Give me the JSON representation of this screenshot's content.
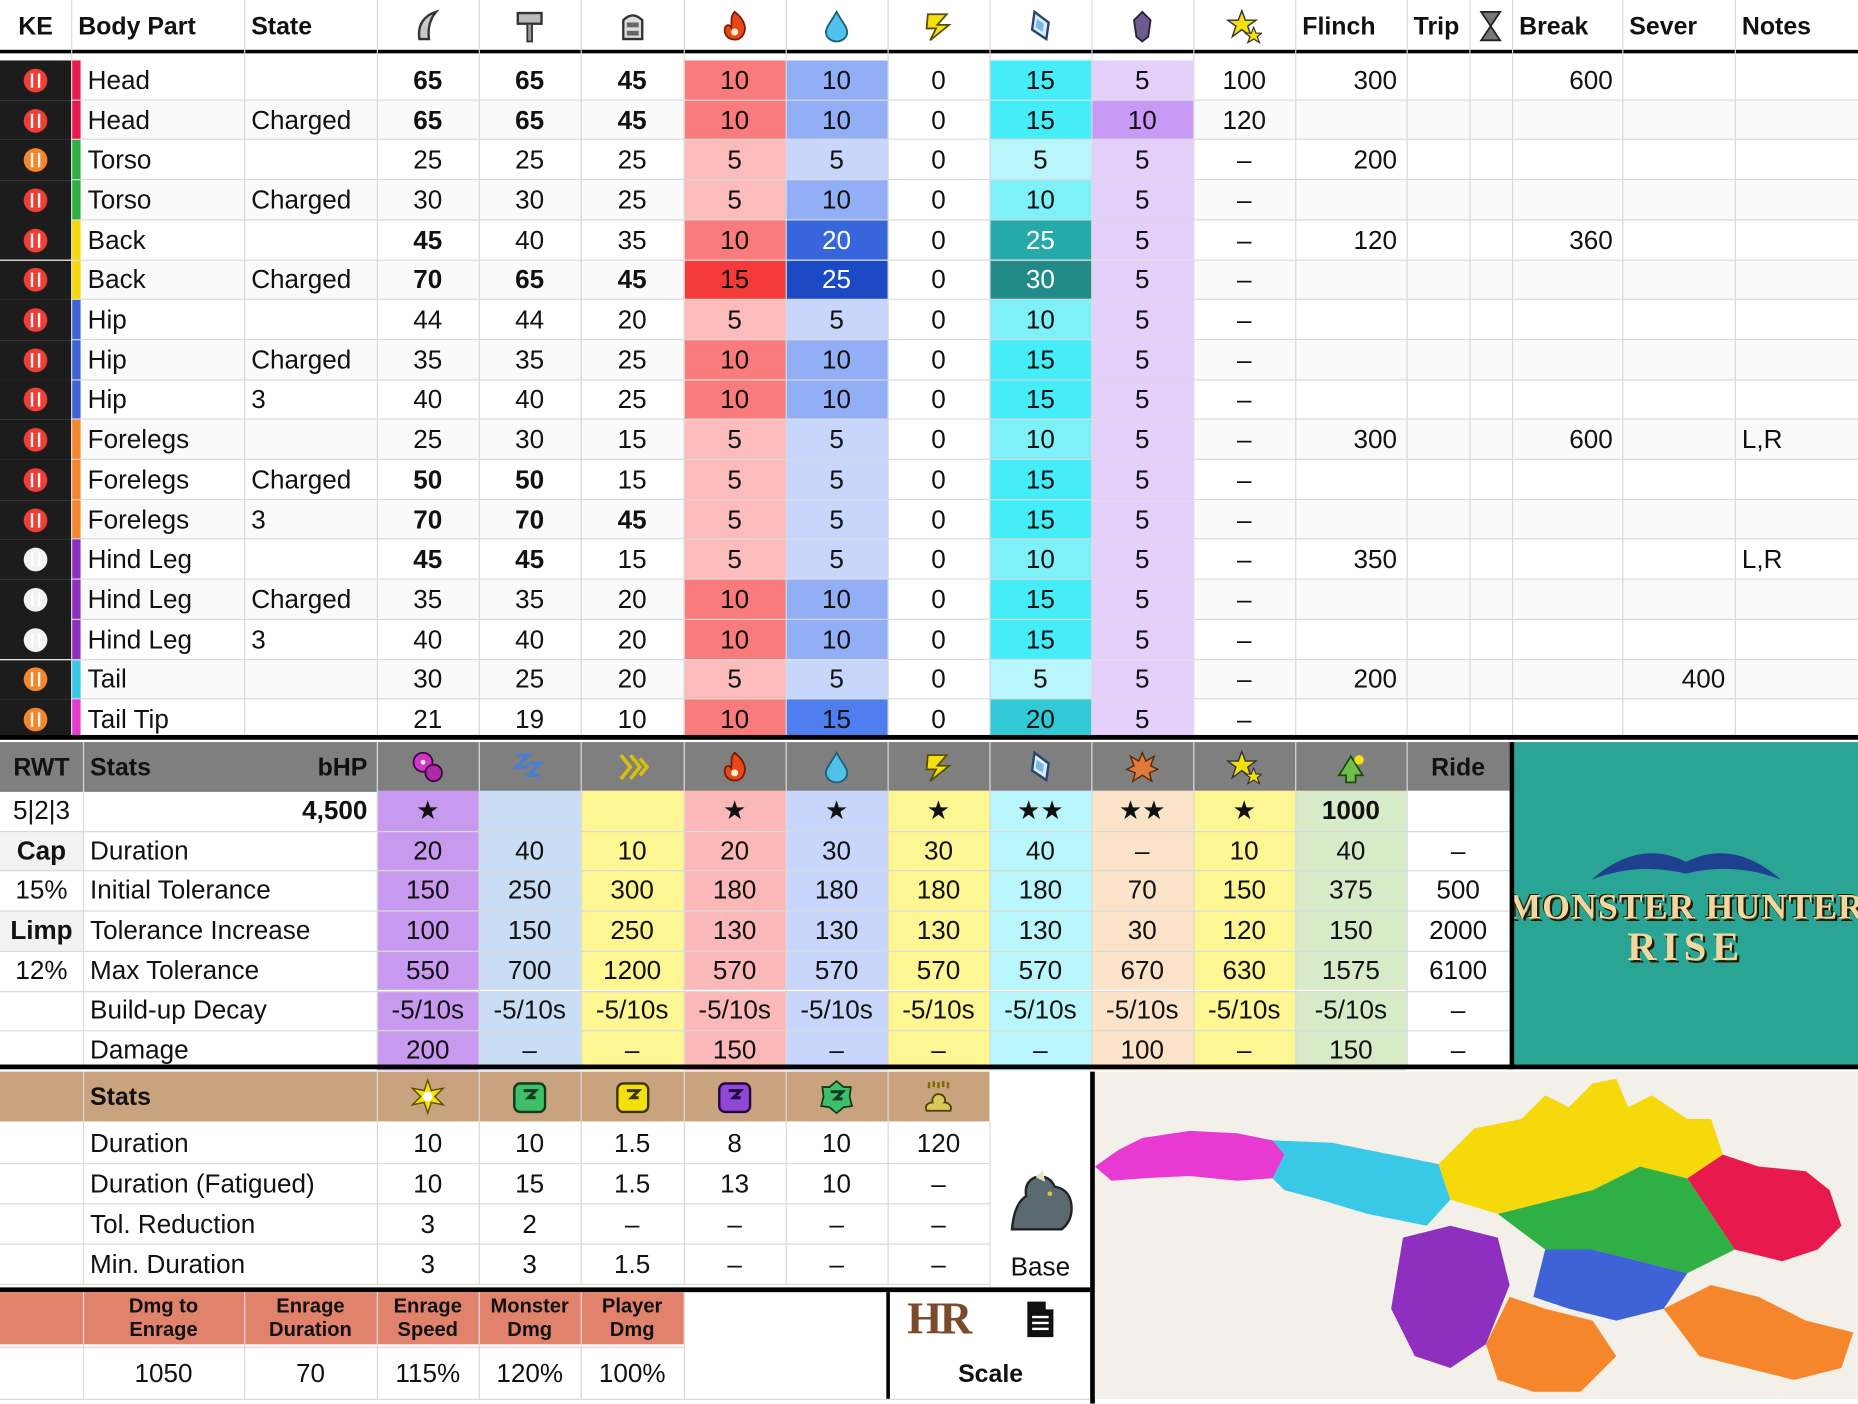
{
  "colors": {
    "weak_bg": "#f2f2f2",
    "header_bg": "#ffffff",
    "ke_column_bg": "#1c1c1c",
    "mid_header_bg": "#7f7f7f",
    "lower_header_bg": "#c9a27e",
    "enrage_header_bg": "#e0826c",
    "logo_panel_bg": "#2aa595",
    "map_bg": "#f3efe9"
  },
  "top_table": {
    "headers": {
      "ke": "KE",
      "body_part": "Body Part",
      "state": "State",
      "flinch": "Flinch",
      "trip": "Trip",
      "break": "Break",
      "sever": "Sever",
      "notes": "Notes"
    },
    "icon_headers": [
      "sever-icon",
      "blunt-icon",
      "ammo-icon",
      "fire-icon",
      "water-icon",
      "thunder-icon",
      "ice-icon",
      "dragon-icon",
      "stun-icon",
      "hourglass-icon"
    ],
    "rows": [
      {
        "ke": "red",
        "color": "#e8194d",
        "part": "Head",
        "state": "",
        "cut": "65",
        "blunt": "65",
        "ammo": "45",
        "fire": "10",
        "water": "10",
        "thunder": "0",
        "ice": "15",
        "dragon": "5",
        "stun": "100",
        "flinch": "300",
        "trip": "",
        "break": "600",
        "sever": "",
        "notes": ""
      },
      {
        "ke": "red",
        "color": "#e8194d",
        "part": "Head",
        "state": "Charged",
        "cut": "65",
        "blunt": "65",
        "ammo": "45",
        "fire": "10",
        "water": "10",
        "thunder": "0",
        "ice": "15",
        "dragon": "10",
        "stun": "120",
        "flinch": "",
        "trip": "",
        "break": "",
        "sever": "",
        "notes": ""
      },
      {
        "ke": "orange",
        "color": "#2fb044",
        "part": "Torso",
        "state": "",
        "cut": "25",
        "blunt": "25",
        "ammo": "25",
        "fire": "5",
        "water": "5",
        "thunder": "0",
        "ice": "5",
        "dragon": "5",
        "stun": "–",
        "flinch": "200",
        "trip": "",
        "break": "",
        "sever": "",
        "notes": ""
      },
      {
        "ke": "red",
        "color": "#2fb044",
        "part": "Torso",
        "state": "Charged",
        "cut": "30",
        "blunt": "30",
        "ammo": "25",
        "fire": "5",
        "water": "10",
        "thunder": "0",
        "ice": "10",
        "dragon": "5",
        "stun": "–",
        "flinch": "",
        "trip": "",
        "break": "",
        "sever": "",
        "notes": ""
      },
      {
        "ke": "red",
        "color": "#f6d90a",
        "part": "Back",
        "state": "",
        "cut": "45",
        "blunt": "40",
        "ammo": "35",
        "fire": "10",
        "water": "20",
        "thunder": "0",
        "ice": "25",
        "dragon": "5",
        "stun": "–",
        "flinch": "120",
        "trip": "",
        "break": "360",
        "sever": "",
        "notes": ""
      },
      {
        "ke": "red",
        "color": "#f6d90a",
        "part": "Back",
        "state": "Charged",
        "cut": "70",
        "blunt": "65",
        "ammo": "45",
        "fire": "15",
        "water": "25",
        "thunder": "0",
        "ice": "30",
        "dragon": "5",
        "stun": "–",
        "flinch": "",
        "trip": "",
        "break": "",
        "sever": "",
        "notes": ""
      },
      {
        "ke": "red",
        "color": "#3f63d6",
        "part": "Hip",
        "state": "",
        "cut": "44",
        "blunt": "44",
        "ammo": "20",
        "fire": "5",
        "water": "5",
        "thunder": "0",
        "ice": "10",
        "dragon": "5",
        "stun": "–",
        "flinch": "",
        "trip": "",
        "break": "",
        "sever": "",
        "notes": ""
      },
      {
        "ke": "red",
        "color": "#3f63d6",
        "part": "Hip",
        "state": "Charged",
        "cut": "35",
        "blunt": "35",
        "ammo": "25",
        "fire": "10",
        "water": "10",
        "thunder": "0",
        "ice": "15",
        "dragon": "5",
        "stun": "–",
        "flinch": "",
        "trip": "",
        "break": "",
        "sever": "",
        "notes": ""
      },
      {
        "ke": "red",
        "color": "#3f63d6",
        "part": "Hip",
        "state": "3",
        "cut": "40",
        "blunt": "40",
        "ammo": "25",
        "fire": "10",
        "water": "10",
        "thunder": "0",
        "ice": "15",
        "dragon": "5",
        "stun": "–",
        "flinch": "",
        "trip": "",
        "break": "",
        "sever": "",
        "notes": ""
      },
      {
        "ke": "red",
        "color": "#f5862b",
        "part": "Forelegs",
        "state": "",
        "cut": "25",
        "blunt": "30",
        "ammo": "15",
        "fire": "5",
        "water": "5",
        "thunder": "0",
        "ice": "10",
        "dragon": "5",
        "stun": "–",
        "flinch": "300",
        "trip": "",
        "break": "600",
        "sever": "",
        "notes": "L,R"
      },
      {
        "ke": "red",
        "color": "#f5862b",
        "part": "Forelegs",
        "state": "Charged",
        "cut": "50",
        "blunt": "50",
        "ammo": "15",
        "fire": "5",
        "water": "5",
        "thunder": "0",
        "ice": "15",
        "dragon": "5",
        "stun": "–",
        "flinch": "",
        "trip": "",
        "break": "",
        "sever": "",
        "notes": ""
      },
      {
        "ke": "red",
        "color": "#f5862b",
        "part": "Forelegs",
        "state": "3",
        "cut": "70",
        "blunt": "70",
        "ammo": "45",
        "fire": "5",
        "water": "5",
        "thunder": "0",
        "ice": "15",
        "dragon": "5",
        "stun": "–",
        "flinch": "",
        "trip": "",
        "break": "",
        "sever": "",
        "notes": ""
      },
      {
        "ke": "white",
        "color": "#8e2fbf",
        "part": "Hind Leg",
        "state": "",
        "cut": "45",
        "blunt": "45",
        "ammo": "15",
        "fire": "5",
        "water": "5",
        "thunder": "0",
        "ice": "10",
        "dragon": "5",
        "stun": "–",
        "flinch": "350",
        "trip": "",
        "break": "",
        "sever": "",
        "notes": "L,R"
      },
      {
        "ke": "white",
        "color": "#8e2fbf",
        "part": "Hind Leg",
        "state": "Charged",
        "cut": "35",
        "blunt": "35",
        "ammo": "20",
        "fire": "10",
        "water": "10",
        "thunder": "0",
        "ice": "15",
        "dragon": "5",
        "stun": "–",
        "flinch": "",
        "trip": "",
        "break": "",
        "sever": "",
        "notes": ""
      },
      {
        "ke": "white",
        "color": "#8e2fbf",
        "part": "Hind Leg",
        "state": "3",
        "cut": "40",
        "blunt": "40",
        "ammo": "20",
        "fire": "10",
        "water": "10",
        "thunder": "0",
        "ice": "15",
        "dragon": "5",
        "stun": "–",
        "flinch": "",
        "trip": "",
        "break": "",
        "sever": "",
        "notes": ""
      },
      {
        "ke": "orange",
        "color": "#39c8e6",
        "part": "Tail",
        "state": "",
        "cut": "30",
        "blunt": "25",
        "ammo": "20",
        "fire": "5",
        "water": "5",
        "thunder": "0",
        "ice": "5",
        "dragon": "5",
        "stun": "–",
        "flinch": "200",
        "trip": "",
        "break": "",
        "sever": "400",
        "notes": ""
      },
      {
        "ke": "orange",
        "color": "#e83ad2",
        "part": "Tail Tip",
        "state": "",
        "cut": "21",
        "blunt": "19",
        "ammo": "10",
        "fire": "10",
        "water": "15",
        "thunder": "0",
        "ice": "20",
        "dragon": "5",
        "stun": "–",
        "flinch": "",
        "trip": "",
        "break": "",
        "sever": "",
        "notes": ""
      }
    ]
  },
  "status_table": {
    "rwt_label": "RWT",
    "stats_label": "Stats",
    "bhp_label": "bHP",
    "ride_label": "Ride",
    "rwt_value": "5|2|3",
    "hp": "4,500",
    "cap_label": "Cap",
    "cap_value": "15%",
    "limp_label": "Limp",
    "limp_value": "12%",
    "icons": [
      "poison-icon",
      "sleep-icon",
      "paralysis-icon",
      "fire-icon",
      "water-icon",
      "thunder-icon",
      "ice-icon",
      "blast-icon",
      "stun-icon",
      "exhaust-icon"
    ],
    "stars": [
      "★",
      "",
      "",
      "★",
      "★",
      "★",
      "★★",
      "★★",
      "★",
      "1000",
      ""
    ],
    "rows": [
      {
        "label": "Duration",
        "values": [
          "20",
          "40",
          "10",
          "20",
          "30",
          "30",
          "40",
          "–",
          "10",
          "40",
          "–"
        ]
      },
      {
        "label": "Initial Tolerance",
        "values": [
          "150",
          "250",
          "300",
          "180",
          "180",
          "180",
          "180",
          "70",
          "150",
          "375",
          "500"
        ]
      },
      {
        "label": "Tolerance Increase",
        "values": [
          "100",
          "150",
          "250",
          "130",
          "130",
          "130",
          "130",
          "30",
          "120",
          "150",
          "2000"
        ]
      },
      {
        "label": "Max Tolerance",
        "values": [
          "550",
          "700",
          "1200",
          "570",
          "570",
          "570",
          "570",
          "670",
          "630",
          "1575",
          "6100"
        ]
      },
      {
        "label": "Build-up Decay",
        "values": [
          "-5/10s",
          "-5/10s",
          "-5/10s",
          "-5/10s",
          "-5/10s",
          "-5/10s",
          "-5/10s",
          "-5/10s",
          "-5/10s",
          "-5/10s",
          "–"
        ]
      },
      {
        "label": "Damage",
        "values": [
          "200",
          "–",
          "–",
          "150",
          "–",
          "–",
          "–",
          "100",
          "–",
          "150",
          "–"
        ]
      }
    ]
  },
  "logo": {
    "line1": "MONSTER HUNTER",
    "line2": "RISE"
  },
  "trap_table": {
    "stats_label": "Stats",
    "icons": [
      "flash-icon",
      "shock-trap-icon",
      "pitfall-trap-icon",
      "sleep-trap-icon",
      "green-trap-icon",
      "dung-icon"
    ],
    "base_label": "Base",
    "rows": [
      {
        "label": "Duration",
        "values": [
          "10",
          "10",
          "1.5",
          "8",
          "10",
          "120"
        ]
      },
      {
        "label": "Duration (Fatigued)",
        "values": [
          "10",
          "15",
          "1.5",
          "13",
          "10",
          "–"
        ]
      },
      {
        "label": "Tol. Reduction",
        "values": [
          "3",
          "2",
          "–",
          "–",
          "–",
          "–"
        ]
      },
      {
        "label": "Min. Duration",
        "values": [
          "3",
          "3",
          "1.5",
          "–",
          "–",
          "–"
        ]
      }
    ]
  },
  "enrage_table": {
    "headers": [
      "Dmg to\nEnrage",
      "Enrage\nDuration",
      "Enrage\nSpeed",
      "Monster\nDmg",
      "Player\nDmg"
    ],
    "values": [
      "1050",
      "70",
      "115%",
      "120%",
      "100%"
    ],
    "hr_label": "HR",
    "scale_label": "Scale"
  }
}
